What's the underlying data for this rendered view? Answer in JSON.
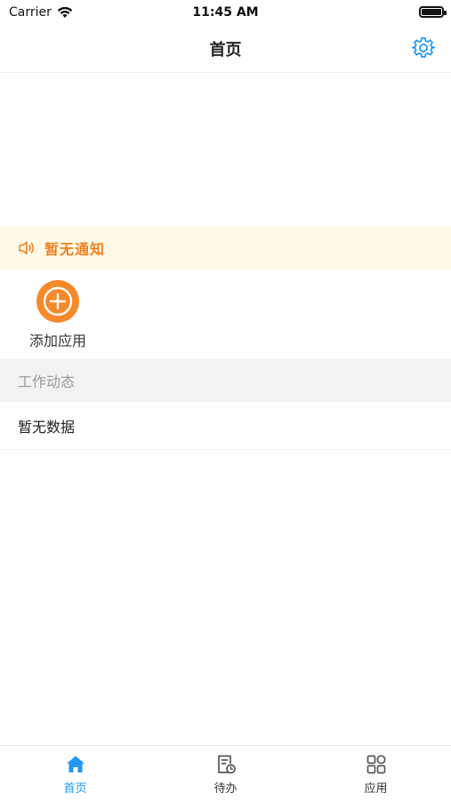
{
  "status_bar": {
    "carrier": "Carrier",
    "time": "11:45 AM"
  },
  "nav": {
    "title": "首页",
    "settings_icon": "gear-icon"
  },
  "notice": {
    "text": "暂无通知",
    "icon": "speaker-icon"
  },
  "apps": {
    "add_label": "添加应用",
    "add_icon": "plus-icon"
  },
  "work_feed": {
    "header": "工作动态",
    "empty_text": "暂无数据"
  },
  "tab_bar": {
    "tabs": [
      {
        "label": "首页",
        "icon": "home-icon",
        "active": true
      },
      {
        "label": "待办",
        "icon": "todo-icon",
        "active": false
      },
      {
        "label": "应用",
        "icon": "apps-grid-icon",
        "active": false
      }
    ]
  },
  "colors": {
    "accent": "#2196f3",
    "orange": "#f58a2c",
    "notice_text": "#f2801f",
    "notice_bg": "#fff9e6"
  }
}
